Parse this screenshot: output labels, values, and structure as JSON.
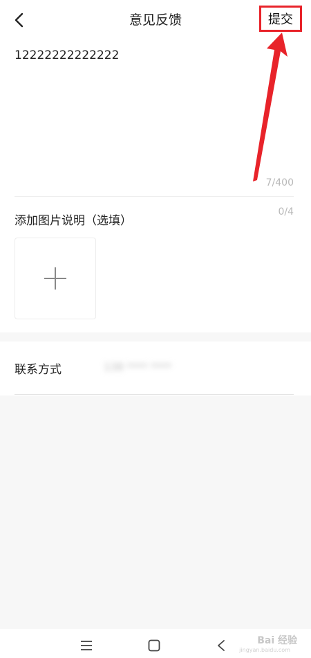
{
  "header": {
    "title": "意见反馈",
    "submit_label": "提交"
  },
  "feedback": {
    "text": "12222222222222",
    "char_count": "7/400"
  },
  "images": {
    "label": "添加图片说明（选填）",
    "count": "0/4"
  },
  "contact": {
    "label": "联系方式",
    "value": "138 **** ****"
  },
  "watermark": {
    "brand": "Bai 经验",
    "url": "jingyan.baidu.com"
  },
  "colors": {
    "accent_red": "#e8232a",
    "background": "#f7f7f7"
  },
  "icons": {
    "back": "chevron-left-icon",
    "add": "plus-icon",
    "menu": "menu-icon",
    "home": "home-icon",
    "nav_back": "back-icon"
  }
}
